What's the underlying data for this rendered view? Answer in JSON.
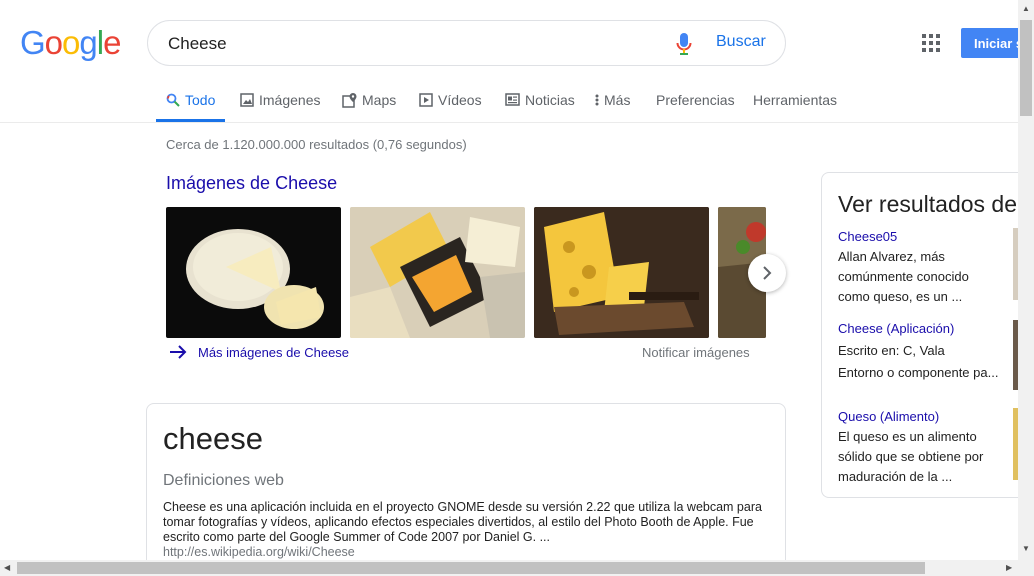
{
  "logo": {
    "letters": [
      "G",
      "o",
      "o",
      "g",
      "l",
      "e"
    ],
    "colors": [
      "#4285f4",
      "#ea4335",
      "#fbbc05",
      "#4285f4",
      "#34a853",
      "#ea4335"
    ]
  },
  "search": {
    "query": "Cheese",
    "button_label": "Buscar"
  },
  "header": {
    "signin_label": "Iniciar s"
  },
  "tabs": [
    {
      "label": "Todo",
      "icon": "search-icon"
    },
    {
      "label": "Imágenes",
      "icon": "image-icon"
    },
    {
      "label": "Maps",
      "icon": "map-icon"
    },
    {
      "label": "Vídeos",
      "icon": "play-icon"
    },
    {
      "label": "Noticias",
      "icon": "news-icon"
    },
    {
      "label": "Más",
      "icon": "more-vertical-icon"
    },
    {
      "label": "Preferencias"
    },
    {
      "label": "Herramientas"
    }
  ],
  "results_stats": "Cerca de 1.120.000.000 resultados (0,76 segundos)",
  "images": {
    "heading": "Imágenes de Cheese",
    "more_link": "Más imágenes de Cheese",
    "report_link": "Notificar imágenes"
  },
  "definition": {
    "word": "cheese",
    "source_title": "Definiciones web",
    "text": "Cheese es una aplicación incluida en el proyecto GNOME desde su versión 2.22 que utiliza la webcam para tomar fotografías y vídeos, aplicando efectos especiales divertidos, al estilo del Photo Booth de Apple. Fue escrito como parte del Google Summer of Code 2007 por Daniel G. ...",
    "url": "http://es.wikipedia.org/wiki/Cheese"
  },
  "side_panel": {
    "title": "Ver resultados de",
    "items": [
      {
        "title": "Cheese05",
        "desc": "Allan Alvarez, más comúnmente conocido como queso, es un ..."
      },
      {
        "title": "Cheese (Aplicación)",
        "desc_line1": "Escrito en: C, Vala",
        "desc_line2": "Entorno o componente pa..."
      },
      {
        "title": "Queso (Alimento)",
        "desc": "El queso es un alimento sólido que se obtiene por maduración de la ..."
      }
    ]
  }
}
